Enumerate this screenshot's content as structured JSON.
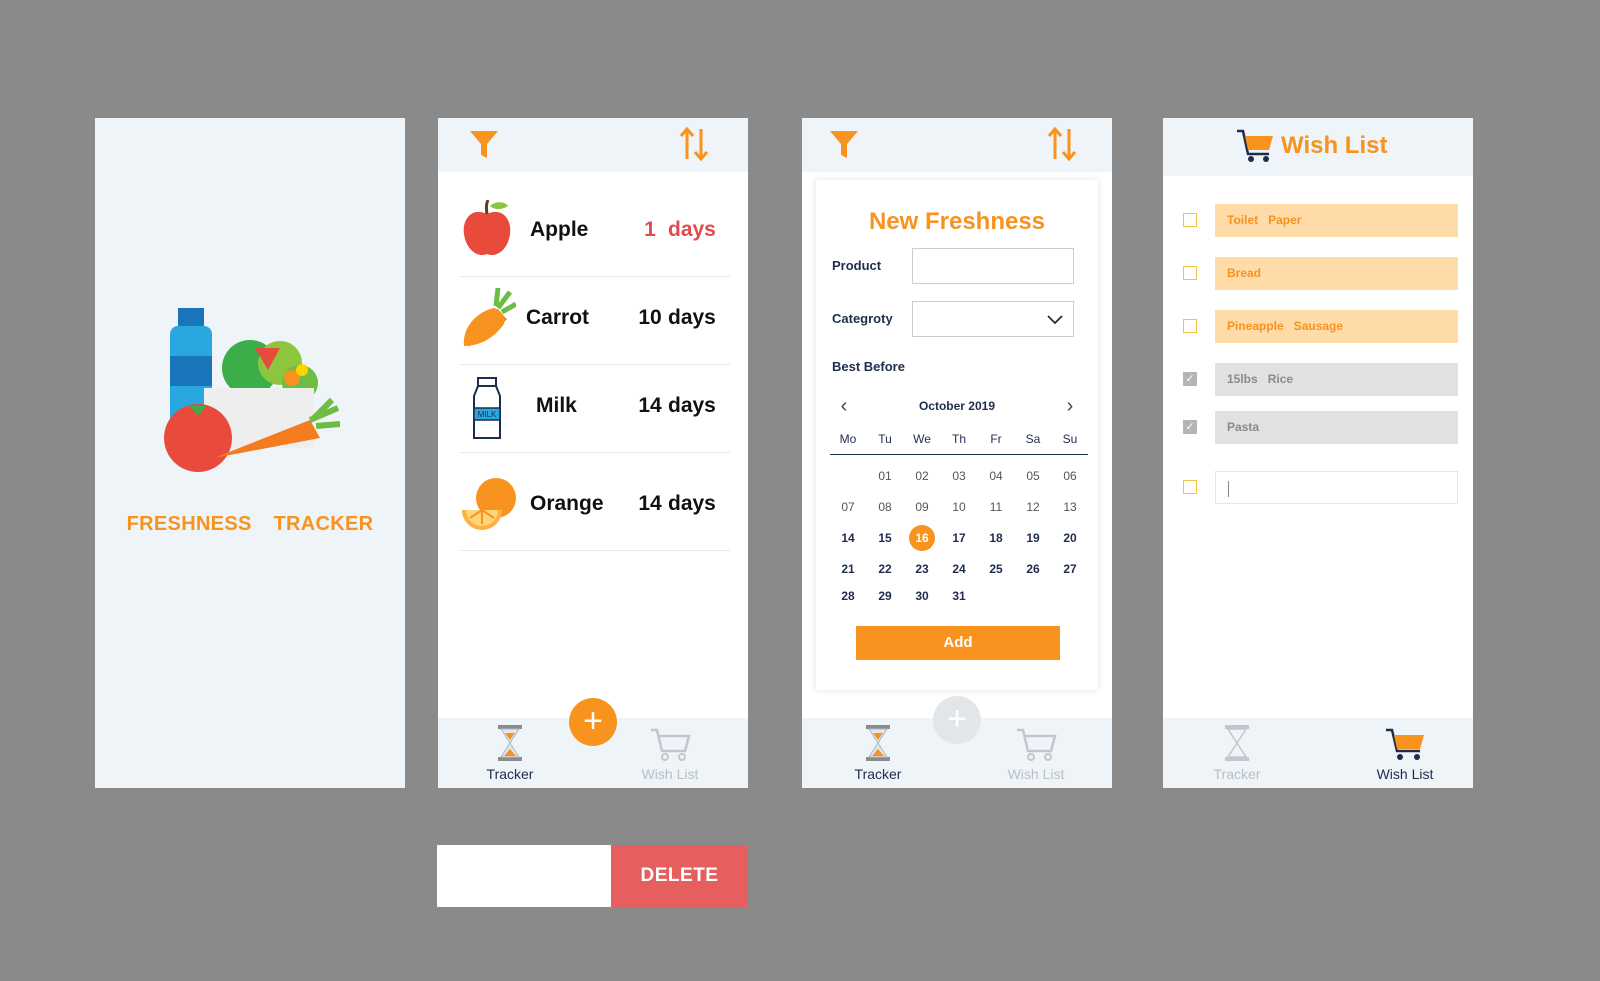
{
  "splash": {
    "brand_words": [
      "FRESHNESS",
      "TRACKER"
    ]
  },
  "tracker": {
    "items": [
      {
        "name": "Apple",
        "days": "1",
        "unit": "days",
        "icon": "apple-icon"
      },
      {
        "name": "Carrot",
        "days": "10",
        "unit": "days",
        "icon": "carrot-icon"
      },
      {
        "name": "Milk",
        "days": "14",
        "unit": "days",
        "icon": "milk-icon"
      },
      {
        "name": "Orange",
        "days": "14",
        "unit": "days",
        "icon": "orange-icon"
      }
    ],
    "fab_label": "+"
  },
  "tabs": {
    "tracker": "Tracker",
    "wishlist": "Wish List"
  },
  "new_freshness": {
    "title": "New Freshness",
    "product_label": "Product",
    "category_label": "Categroty",
    "best_before_label": "Best Before",
    "calendar": {
      "month": "October 2019",
      "weekdays": [
        "Mo",
        "Tu",
        "We",
        "Th",
        "Fr",
        "Sa",
        "Su"
      ],
      "weeks": [
        [
          "",
          "01",
          "02",
          "03",
          "04",
          "05",
          "06"
        ],
        [
          "07",
          "08",
          "09",
          "10",
          "11",
          "12",
          "13"
        ],
        [
          "14",
          "15",
          "16",
          "17",
          "18",
          "19",
          "20"
        ],
        [
          "21",
          "22",
          "23",
          "24",
          "25",
          "26",
          "27"
        ],
        [
          "28",
          "29",
          "30",
          "31",
          "",
          "",
          ""
        ]
      ],
      "selected": "16"
    },
    "add_label": "Add"
  },
  "wishlist": {
    "title": "Wish List",
    "items": [
      {
        "text": "Toilet   Paper",
        "checked": false
      },
      {
        "text": "Bread",
        "checked": false
      },
      {
        "text": "Pineapple   Sausage",
        "checked": false
      },
      {
        "text": "15lbs   Rice",
        "checked": true
      },
      {
        "text": "Pasta",
        "checked": true
      }
    ]
  },
  "delete_label": "DELETE",
  "colors": {
    "accent": "#f7931e",
    "danger": "#e55f5f",
    "navy": "#1f2d4d",
    "background": "#8a8a8a"
  }
}
